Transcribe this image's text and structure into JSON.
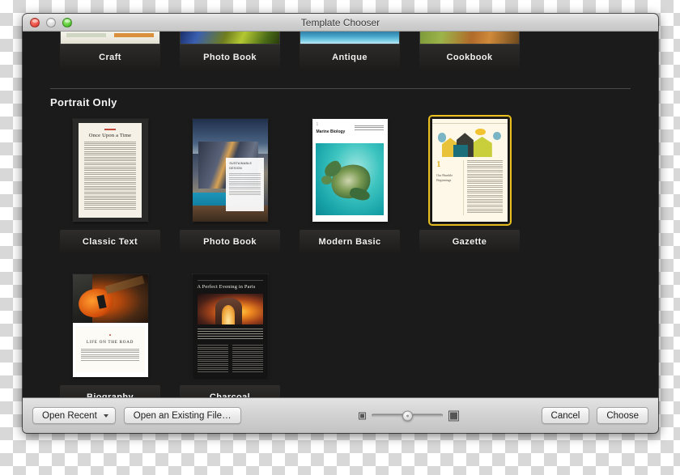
{
  "window": {
    "title": "Template Chooser",
    "controls": {
      "close": "close-button",
      "minimize": "minimize-button",
      "zoom": "zoom-button"
    }
  },
  "scrolled_row": {
    "templates": [
      {
        "label": "Craft"
      },
      {
        "label": "Photo Book"
      },
      {
        "label": "Antique"
      },
      {
        "label": "Cookbook"
      }
    ]
  },
  "section": {
    "title": "Portrait Only",
    "templates": [
      {
        "label": "Classic Text",
        "selected": false,
        "preview": {
          "heading": "Once Upon a Time"
        }
      },
      {
        "label": "Photo Book",
        "selected": false,
        "preview": {
          "heading": "SUSTAINABLE DESIGN"
        }
      },
      {
        "label": "Modern Basic",
        "selected": false,
        "preview": {
          "heading": "Marine Biology",
          "number": "1"
        }
      },
      {
        "label": "Gazette",
        "selected": true,
        "preview": {
          "number": "1",
          "heading": "Our Humble Beginnings"
        }
      },
      {
        "label": "Biography",
        "selected": false,
        "preview": {
          "heading": "LIFE ON THE ROAD"
        }
      },
      {
        "label": "Charcoal",
        "selected": false,
        "preview": {
          "heading": "A Perfect Evening in Paris"
        }
      }
    ]
  },
  "toolbar": {
    "open_recent_label": "Open Recent",
    "open_existing_label": "Open an Existing File…",
    "cancel_label": "Cancel",
    "choose_label": "Choose",
    "slider": {
      "small_icon": "small-thumbnail-icon",
      "large_icon": "large-thumbnail-icon",
      "value": 50
    }
  },
  "colors": {
    "selection": "#E8BF1E",
    "window_chrome": "#D2D2D2",
    "browser_bg": "#1B1B1B"
  }
}
